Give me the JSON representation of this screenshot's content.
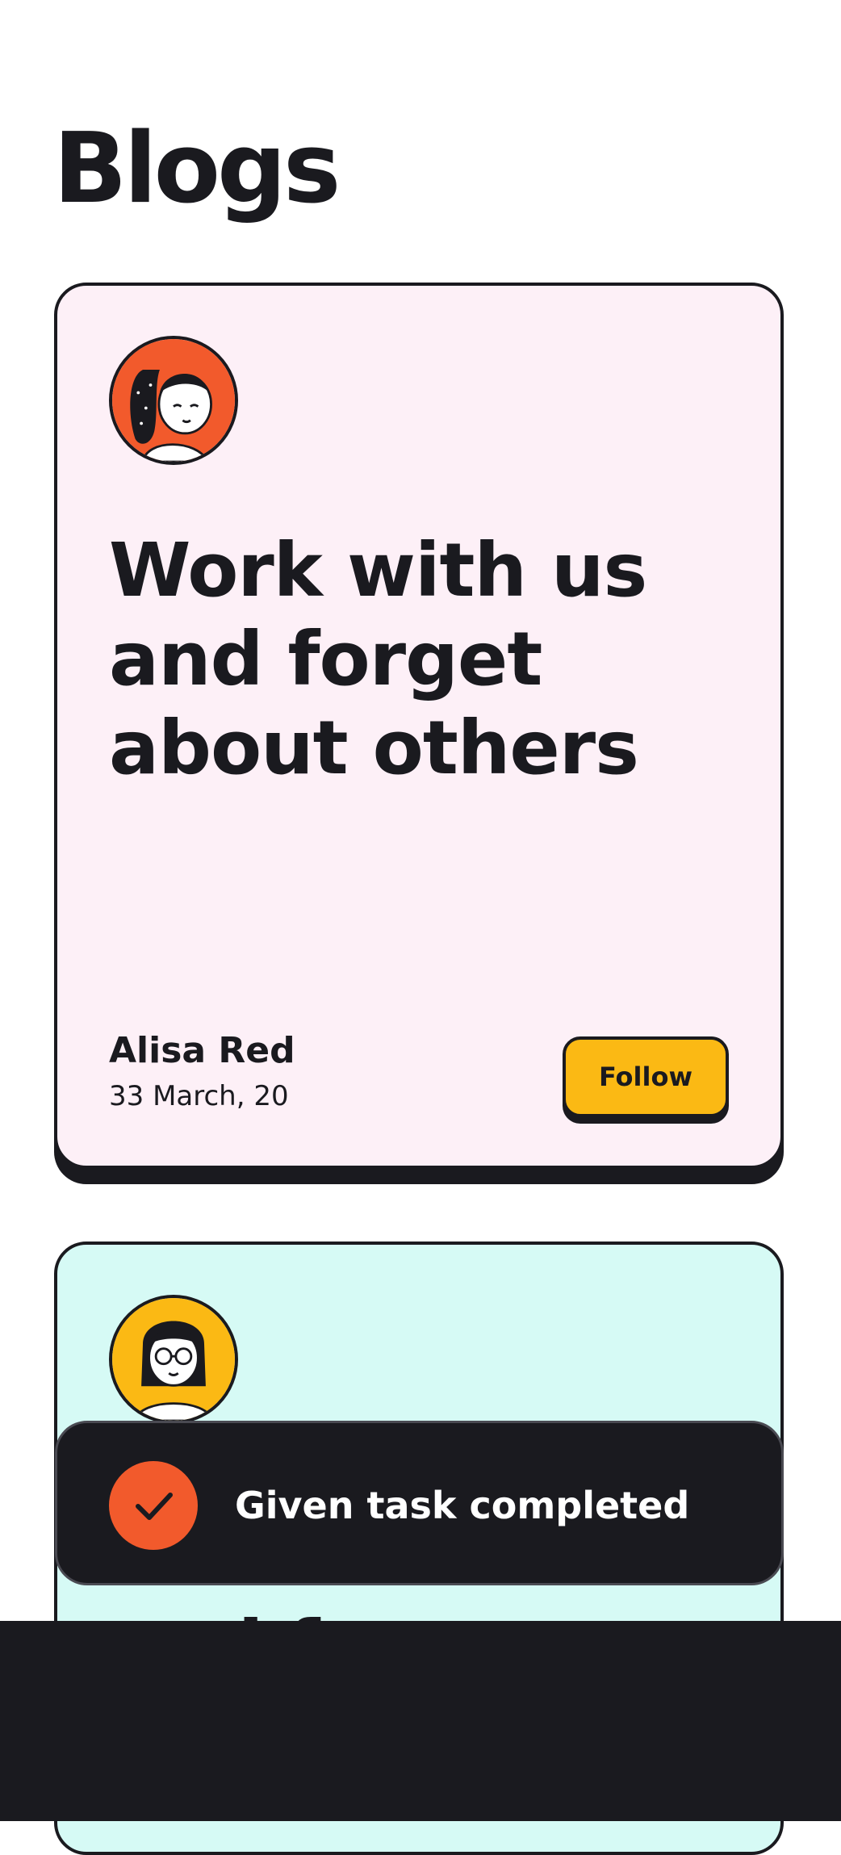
{
  "page": {
    "title": "Blogs"
  },
  "posts": [
    {
      "avatar_icon": "avatar-ponytail-girl-icon",
      "avatar_bg": "#f25a2c",
      "card_bg": "#fdf0f7",
      "headline": "Work with us and forget about others",
      "author": "Alisa Red",
      "date": "33 March, 20",
      "follow_label": "Follow"
    },
    {
      "avatar_icon": "avatar-glasses-girl-icon",
      "avatar_bg": "#fbb914",
      "card_bg": "#d6faf5",
      "headline": "and forget"
    }
  ],
  "toast": {
    "icon": "check-icon",
    "message": "Given task completed",
    "accent": "#f25a2c"
  },
  "colors": {
    "ink": "#1a1a1f",
    "button": "#fbb914"
  }
}
